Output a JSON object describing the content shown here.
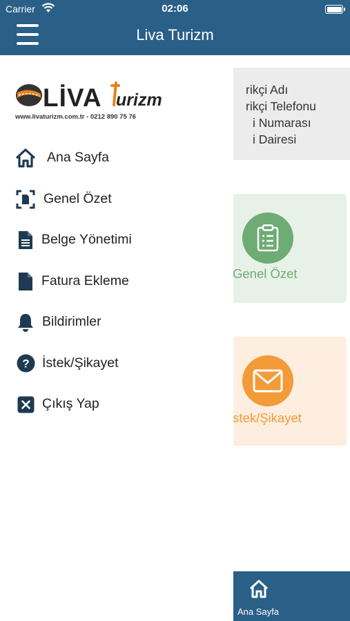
{
  "status_bar": {
    "carrier": "Carrier",
    "time": "02:06"
  },
  "nav": {
    "title": "Liva Turizm"
  },
  "logo": {
    "contact": "www.livaturizm.com.tr - 0212 890 75 76"
  },
  "drawer": {
    "items": [
      {
        "label": "Ana Sayfa",
        "icon": "home-icon"
      },
      {
        "label": "Genel Özet",
        "icon": "document-scan-icon"
      },
      {
        "label": "Belge Yönetimi",
        "icon": "file-text-icon"
      },
      {
        "label": "Fatura Ekleme",
        "icon": "file-icon"
      },
      {
        "label": "Bildirimler",
        "icon": "bell-icon"
      },
      {
        "label": "İstek/Şikayet",
        "icon": "question-icon"
      },
      {
        "label": "Çıkış Yap",
        "icon": "close-square-icon"
      }
    ]
  },
  "main": {
    "info_rows": [
      "rikçi Adı",
      "rikçi Telefonu",
      "i Numarası",
      "i Dairesi"
    ],
    "tiles": [
      {
        "label": "Genel Özet",
        "icon": "clipboard-icon",
        "color": "#6fab74"
      },
      {
        "label": "İstek/Şikayet",
        "icon": "mail-icon",
        "color": "#f39b38"
      }
    ],
    "tabbar": {
      "label": "Ana Sayfa",
      "icon": "home-icon"
    }
  },
  "colors": {
    "primary": "#2a5f87",
    "green": "#6fab74",
    "orange": "#f39b38",
    "logo_orange": "#e8821e"
  }
}
